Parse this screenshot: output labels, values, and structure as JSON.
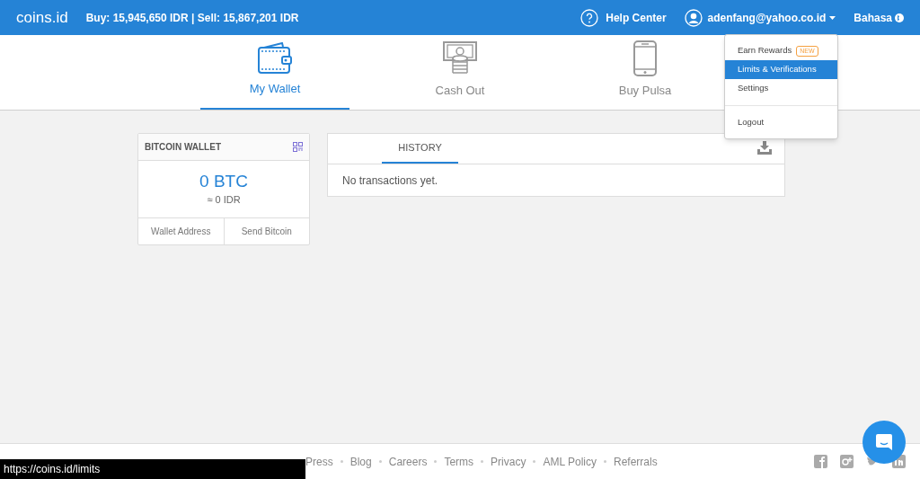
{
  "header": {
    "logo": "coins.id",
    "rates": "Buy: 15,945,650 IDR | Sell: 15,867,201 IDR",
    "help": "Help Center",
    "account": "adenfang@yahoo.co.id",
    "language": "Bahasa"
  },
  "menu": [
    {
      "label": "Earn Rewards",
      "badge": "NEW",
      "selected": false
    },
    {
      "label": "Limits & Verifications",
      "selected": true
    },
    {
      "label": "Settings",
      "selected": false
    },
    {
      "label": "Logout",
      "selected": false,
      "divider_before": true
    }
  ],
  "tabs": [
    {
      "label": "My Wallet",
      "kind": "wallet",
      "selected": true
    },
    {
      "label": "Cash Out",
      "kind": "cash",
      "selected": false
    },
    {
      "label": "Buy Pulsa",
      "kind": "phone",
      "selected": false
    }
  ],
  "wallet": {
    "title": "BITCOIN WALLET",
    "balance": "0 BTC",
    "fiat": "≈ 0 IDR",
    "actions": [
      "Wallet Address",
      "Send Bitcoin"
    ]
  },
  "history": {
    "tab": "HISTORY",
    "empty": "No transactions yet."
  },
  "footer": {
    "links": [
      "Press",
      "Blog",
      "Careers",
      "Terms",
      "Privacy",
      "AML Policy",
      "Referrals"
    ]
  },
  "status_bar": "https://coins.id/limits"
}
